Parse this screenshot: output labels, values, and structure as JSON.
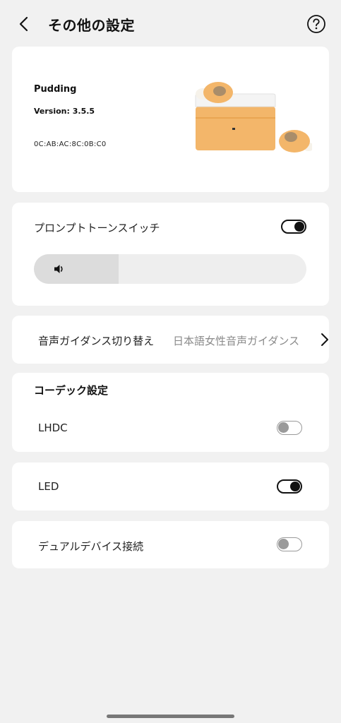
{
  "header": {
    "title": "その他の設定",
    "back_icon": "chevron-left-icon",
    "help_icon": "question-circle-icon"
  },
  "device": {
    "name": "Pudding",
    "version": "Version: 3.5.5",
    "mac": "0C:AB:AC:8C:0B:C0",
    "image": "earbuds-case-image"
  },
  "prompt_tone": {
    "label": "プロンプトトーンスイッチ",
    "enabled": true,
    "volume_icon": "speaker-icon",
    "volume_fraction": 0.31
  },
  "voice_guidance": {
    "label": "音声ガイダンス切り替え",
    "value": "日本語女性音声ガイダンス",
    "chevron_icon": "chevron-right-icon"
  },
  "codec": {
    "title": "コーデック設定",
    "lhdc_label": "LHDC",
    "lhdc_enabled": false
  },
  "led": {
    "label": "LED",
    "enabled": true
  },
  "dual_device": {
    "label": "デュアルデバイス接続",
    "enabled": false
  },
  "colors": {
    "background": "#f1f1f1",
    "card": "#ffffff",
    "toggle_on": "#111111",
    "toggle_off": "#9a9a9a",
    "product_orange": "#f3b66a"
  }
}
